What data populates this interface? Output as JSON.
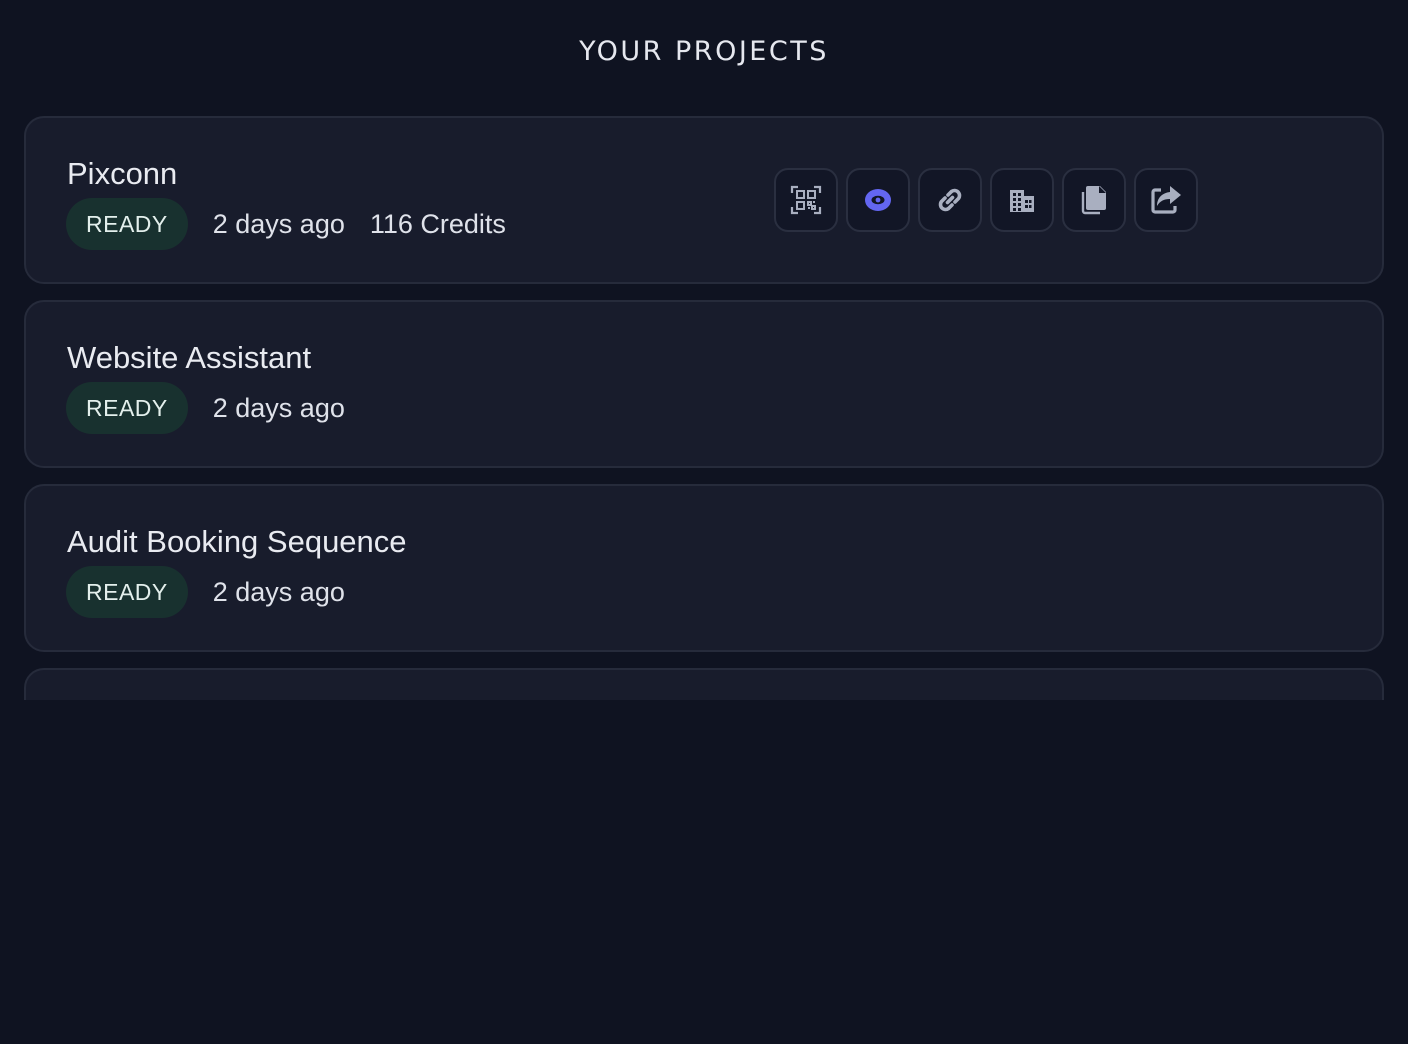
{
  "page_title": "YOUR PROJECTS",
  "projects": [
    {
      "name": "Pixconn",
      "status": "READY",
      "updated": "2 days ago",
      "credits": "116 Credits",
      "actions": [
        "qr-code-icon",
        "eye-icon",
        "link-icon",
        "building-icon",
        "copy-icon",
        "share-icon"
      ]
    },
    {
      "name": "Website Assistant",
      "status": "READY",
      "updated": "2 days ago"
    },
    {
      "name": "Audit Booking Sequence",
      "status": "READY",
      "updated": "2 days ago"
    }
  ],
  "colors": {
    "background": "#0f1321",
    "card": "#181c2c",
    "card_border": "#262b3b",
    "badge_bg": "#18312f",
    "icon": "#a9afc0",
    "accent": "#6366f1"
  }
}
